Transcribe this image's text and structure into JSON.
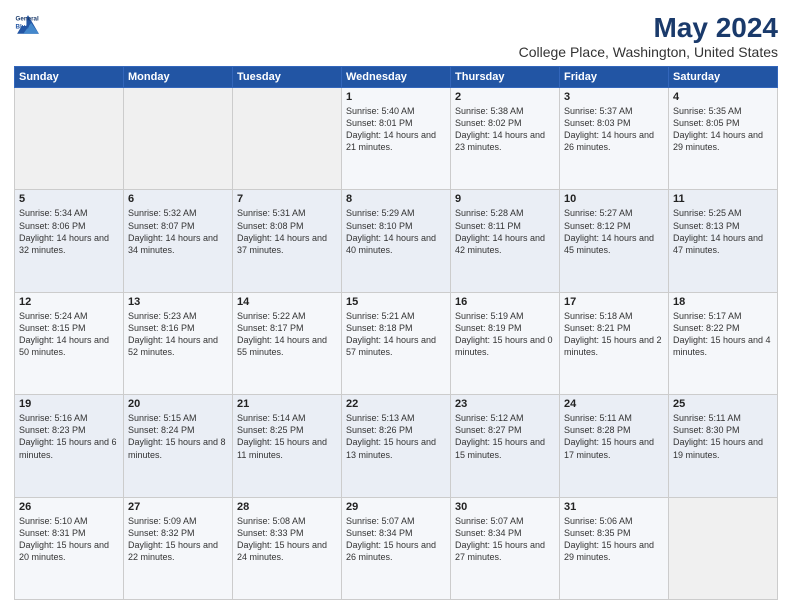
{
  "header": {
    "logo_line1": "General",
    "logo_line2": "Blue",
    "title": "May 2024",
    "subtitle": "College Place, Washington, United States"
  },
  "days_of_week": [
    "Sunday",
    "Monday",
    "Tuesday",
    "Wednesday",
    "Thursday",
    "Friday",
    "Saturday"
  ],
  "weeks": [
    [
      {
        "day": "",
        "text": ""
      },
      {
        "day": "",
        "text": ""
      },
      {
        "day": "",
        "text": ""
      },
      {
        "day": "1",
        "text": "Sunrise: 5:40 AM\nSunset: 8:01 PM\nDaylight: 14 hours\nand 21 minutes."
      },
      {
        "day": "2",
        "text": "Sunrise: 5:38 AM\nSunset: 8:02 PM\nDaylight: 14 hours\nand 23 minutes."
      },
      {
        "day": "3",
        "text": "Sunrise: 5:37 AM\nSunset: 8:03 PM\nDaylight: 14 hours\nand 26 minutes."
      },
      {
        "day": "4",
        "text": "Sunrise: 5:35 AM\nSunset: 8:05 PM\nDaylight: 14 hours\nand 29 minutes."
      }
    ],
    [
      {
        "day": "5",
        "text": "Sunrise: 5:34 AM\nSunset: 8:06 PM\nDaylight: 14 hours\nand 32 minutes."
      },
      {
        "day": "6",
        "text": "Sunrise: 5:32 AM\nSunset: 8:07 PM\nDaylight: 14 hours\nand 34 minutes."
      },
      {
        "day": "7",
        "text": "Sunrise: 5:31 AM\nSunset: 8:08 PM\nDaylight: 14 hours\nand 37 minutes."
      },
      {
        "day": "8",
        "text": "Sunrise: 5:29 AM\nSunset: 8:10 PM\nDaylight: 14 hours\nand 40 minutes."
      },
      {
        "day": "9",
        "text": "Sunrise: 5:28 AM\nSunset: 8:11 PM\nDaylight: 14 hours\nand 42 minutes."
      },
      {
        "day": "10",
        "text": "Sunrise: 5:27 AM\nSunset: 8:12 PM\nDaylight: 14 hours\nand 45 minutes."
      },
      {
        "day": "11",
        "text": "Sunrise: 5:25 AM\nSunset: 8:13 PM\nDaylight: 14 hours\nand 47 minutes."
      }
    ],
    [
      {
        "day": "12",
        "text": "Sunrise: 5:24 AM\nSunset: 8:15 PM\nDaylight: 14 hours\nand 50 minutes."
      },
      {
        "day": "13",
        "text": "Sunrise: 5:23 AM\nSunset: 8:16 PM\nDaylight: 14 hours\nand 52 minutes."
      },
      {
        "day": "14",
        "text": "Sunrise: 5:22 AM\nSunset: 8:17 PM\nDaylight: 14 hours\nand 55 minutes."
      },
      {
        "day": "15",
        "text": "Sunrise: 5:21 AM\nSunset: 8:18 PM\nDaylight: 14 hours\nand 57 minutes."
      },
      {
        "day": "16",
        "text": "Sunrise: 5:19 AM\nSunset: 8:19 PM\nDaylight: 15 hours\nand 0 minutes."
      },
      {
        "day": "17",
        "text": "Sunrise: 5:18 AM\nSunset: 8:21 PM\nDaylight: 15 hours\nand 2 minutes."
      },
      {
        "day": "18",
        "text": "Sunrise: 5:17 AM\nSunset: 8:22 PM\nDaylight: 15 hours\nand 4 minutes."
      }
    ],
    [
      {
        "day": "19",
        "text": "Sunrise: 5:16 AM\nSunset: 8:23 PM\nDaylight: 15 hours\nand 6 minutes."
      },
      {
        "day": "20",
        "text": "Sunrise: 5:15 AM\nSunset: 8:24 PM\nDaylight: 15 hours\nand 8 minutes."
      },
      {
        "day": "21",
        "text": "Sunrise: 5:14 AM\nSunset: 8:25 PM\nDaylight: 15 hours\nand 11 minutes."
      },
      {
        "day": "22",
        "text": "Sunrise: 5:13 AM\nSunset: 8:26 PM\nDaylight: 15 hours\nand 13 minutes."
      },
      {
        "day": "23",
        "text": "Sunrise: 5:12 AM\nSunset: 8:27 PM\nDaylight: 15 hours\nand 15 minutes."
      },
      {
        "day": "24",
        "text": "Sunrise: 5:11 AM\nSunset: 8:28 PM\nDaylight: 15 hours\nand 17 minutes."
      },
      {
        "day": "25",
        "text": "Sunrise: 5:11 AM\nSunset: 8:30 PM\nDaylight: 15 hours\nand 19 minutes."
      }
    ],
    [
      {
        "day": "26",
        "text": "Sunrise: 5:10 AM\nSunset: 8:31 PM\nDaylight: 15 hours\nand 20 minutes."
      },
      {
        "day": "27",
        "text": "Sunrise: 5:09 AM\nSunset: 8:32 PM\nDaylight: 15 hours\nand 22 minutes."
      },
      {
        "day": "28",
        "text": "Sunrise: 5:08 AM\nSunset: 8:33 PM\nDaylight: 15 hours\nand 24 minutes."
      },
      {
        "day": "29",
        "text": "Sunrise: 5:07 AM\nSunset: 8:34 PM\nDaylight: 15 hours\nand 26 minutes."
      },
      {
        "day": "30",
        "text": "Sunrise: 5:07 AM\nSunset: 8:34 PM\nDaylight: 15 hours\nand 27 minutes."
      },
      {
        "day": "31",
        "text": "Sunrise: 5:06 AM\nSunset: 8:35 PM\nDaylight: 15 hours\nand 29 minutes."
      },
      {
        "day": "",
        "text": ""
      }
    ]
  ]
}
